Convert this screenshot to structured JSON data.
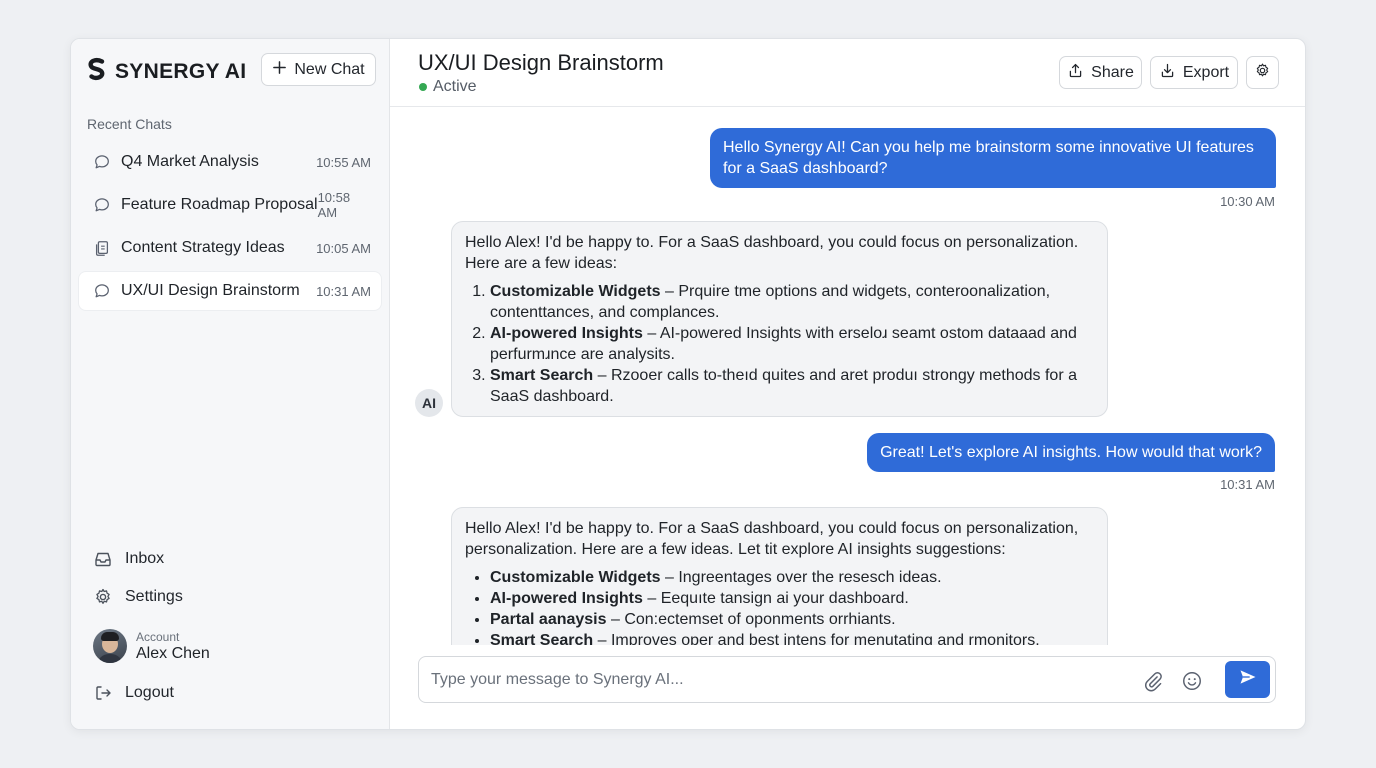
{
  "app": {
    "brand": "SYNERGY AI",
    "new_chat_label": "New Chat"
  },
  "sidebar": {
    "section_label": "Recent Chats",
    "chats": [
      {
        "title": "Q4 Market Analysis",
        "time": "10:55 AM",
        "icon": "chat-bubble-icon"
      },
      {
        "title": "Feature Roadmap Proposal",
        "time": "10:58 AM",
        "icon": "chat-bubble-icon"
      },
      {
        "title": "Content Strategy Ideas",
        "time": "10:05 AM",
        "icon": "document-icon"
      },
      {
        "title": "UX/UI Design Brainstorm",
        "time": "10:31 AM",
        "icon": "chat-bubble-icon",
        "active": true
      }
    ],
    "nav": {
      "inbox": "Inbox",
      "settings": "Settings",
      "logout": "Logout"
    },
    "account": {
      "label": "Account",
      "name": "Alex Chen"
    }
  },
  "header": {
    "title": "UX/UI Design Brainstorm",
    "status": "Active",
    "share_label": "Share",
    "export_label": "Export"
  },
  "messages": {
    "m1": {
      "text": "Hello Synergy AI! Can you help me brainstorm some innovative UI features for a SaaS dashboard?",
      "time": "10:30 AM"
    },
    "m2": {
      "badge": "AI",
      "intro": "Hello Alex! I'd be happy to. For a SaaS dashboard, you could focus on personalization. Here are a few ideas:",
      "items": [
        {
          "bold": "Customizable Widgets",
          "text": " – Prquire tme options and widgets, conteroonalization, contenttances, and complances."
        },
        {
          "bold": "AI-powered Insights",
          "text": " – AI-powered Insights with erseloɹ seamt ostom dataaad and perfurmɹnce are analysits."
        },
        {
          "bold": "Smart Search",
          "text": " – Rzooer calls to-theıd quites and aret produı strongy methods for a SaaS dashboard."
        }
      ]
    },
    "m3": {
      "text": "Great! Let's explore AI insights. How would that work?",
      "time": "10:31 AM"
    },
    "m4": {
      "intro": "Hello Alex! I'd be happy to. For a SaaS dashboard, you could focus on personalization, personalization. Here are a few ideas. Let tit explore AI insights suggestions:",
      "items": [
        {
          "bold": "Customizable Widgets",
          "text": " – Ingreentages over the resesch ideas."
        },
        {
          "bold": "AI-powered Insights",
          "text": " – Eequıte tansign ai your dashboard."
        },
        {
          "bold": "Partal aanaysis",
          "text": " – Con:ectemset of oponments orrhiants."
        },
        {
          "bold": "Smart Search",
          "text": " – Improves oper and best intens for menutating and rmonitors."
        }
      ]
    }
  },
  "composer": {
    "placeholder": "Type your message to Synergy AI..."
  },
  "colors": {
    "accent": "#2f6bd8",
    "status_active": "#34a853"
  }
}
